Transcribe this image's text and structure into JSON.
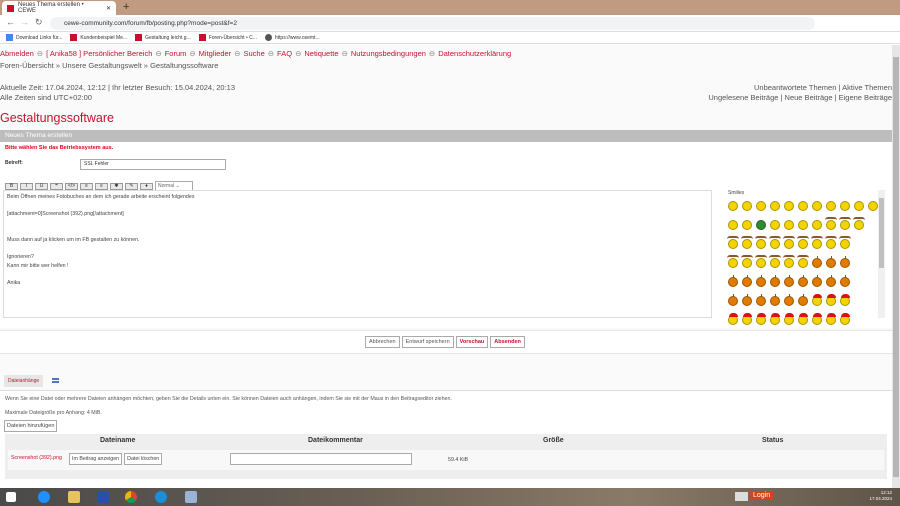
{
  "browser": {
    "tab_title": "Neues Thema erstellen • CEWE",
    "url": "cewe-community.com/forum/fb/posting.php?mode=post&f=2",
    "bookmarks": [
      "Download Links für...",
      "Kundenbeispiel Me...",
      "Gestaltung leicht g...",
      "Foren-Übersicht • C...",
      "https://www.osemt..."
    ]
  },
  "nav": {
    "items": [
      "Abmelden",
      "[ Anika58 ] Persönlicher Bereich",
      "Forum",
      "Mitglieder",
      "Suche",
      "FAQ",
      "Netiquette",
      "Nutzungsbedingungen",
      "Datenschutzerklärung"
    ],
    "breadcrumb": "Foren-Übersicht » Unsere Gestaltungswelt » Gestaltungssoftware"
  },
  "info": {
    "time": "Aktuelle Zeit: 17.04.2024, 12:12 | Ihr letzter Besuch: 15.04.2024, 20:13",
    "tz": "Alle Zeiten sind UTC+02:00",
    "links1": [
      "Unbeantwortete Themen",
      "Aktive Themen"
    ],
    "links2": [
      "Ungelesene Beiträge",
      "Neue Beiträge",
      "Eigene Beiträge"
    ]
  },
  "title": "Gestaltungssoftware",
  "form": {
    "header": "Neues Thema erstellen",
    "warning": "Bitte wählen Sie das Betriebssystem aus.",
    "subject_label": "Betreff:",
    "subject_value": "SSL Fehler",
    "toolbar": [
      "B",
      "I",
      "U",
      "❝",
      "</>",
      "≡",
      "≡",
      "✱",
      "✎",
      "♦"
    ],
    "font_select": "Normal",
    "message": "Beim Öffnen meines Fotobuches an dem ich gerade arbeite erscheint folgendes\n\n[attachment=0]Screenshot (392).png[/attachment]\n\n\nMuss dann auf ja klicken um im FB gestalten zu können.\n\nIgnorieren?\nKann mir bitte wer helfen !\n\nAnika",
    "smilies_label": "Smilies",
    "smilies": [
      "yyyyyyyyyyy",
      "yygyyyyrrr",
      "rrrrrrrrr",
      "rrrrrrppp",
      "ppppppppp",
      "ppppppsss",
      "sssssssss"
    ]
  },
  "buttons": {
    "cancel": "Abbrechen",
    "draft": "Entwurf speichern",
    "preview": "Vorschau",
    "submit": "Absenden"
  },
  "attachments": {
    "tab": "Dateianhänge",
    "info": "Wenn Sie eine Datei oder mehrere Dateien anhängen möchten, geben Sie die Details unten ein. Sie können Dateien auch anhängen, indem Sie sie mit der Maus in den Beitragseditor ziehen.",
    "max": "Maximale Dateigröße pro Anhang: 4 MiB.",
    "add": "Dateien hinzufügen",
    "columns": [
      "Dateiname",
      "Dateikommentar",
      "Größe",
      "Status"
    ],
    "file": {
      "name": "Screenshot (392).png",
      "show": "Im Beitrag anzeigen",
      "delete": "Datei löschen",
      "size": "59.4 KiB"
    }
  },
  "taskbar": {
    "login": "Login",
    "time": "12:12",
    "date": "17.04.2024"
  }
}
